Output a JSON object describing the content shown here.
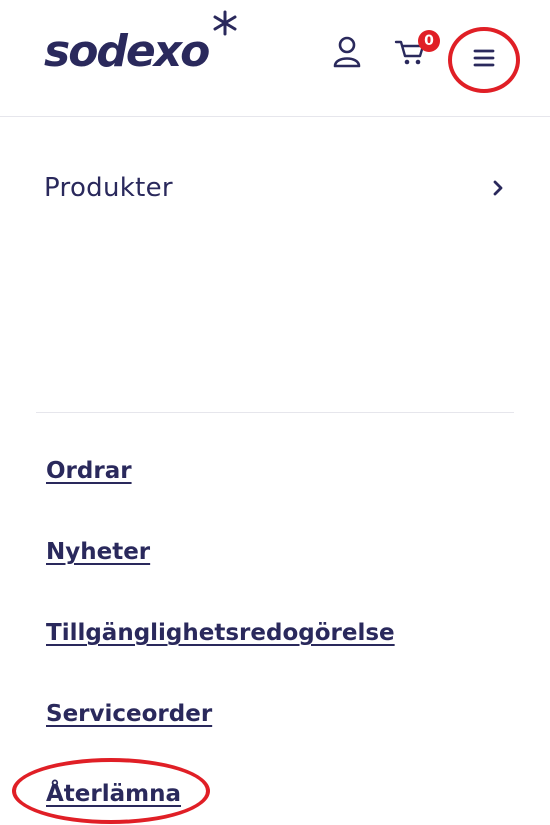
{
  "header": {
    "logo_text": "sodexo",
    "user_icon": "user-icon",
    "cart_icon": "cart-icon",
    "cart_count": "0",
    "menu_icon": "hamburger-menu-icon"
  },
  "menu": {
    "category": {
      "label": "Produkter",
      "icon": "chevron-right-icon"
    },
    "links": [
      {
        "label": "Ordrar"
      },
      {
        "label": "Nyheter"
      },
      {
        "label": "Tillgänglighetsredogörelse"
      },
      {
        "label": "Serviceorder"
      },
      {
        "label": "Återlämna"
      }
    ]
  },
  "colors": {
    "brand_navy": "#2a295c",
    "highlight_red": "#e01f26",
    "divider": "#e6e6ec"
  }
}
